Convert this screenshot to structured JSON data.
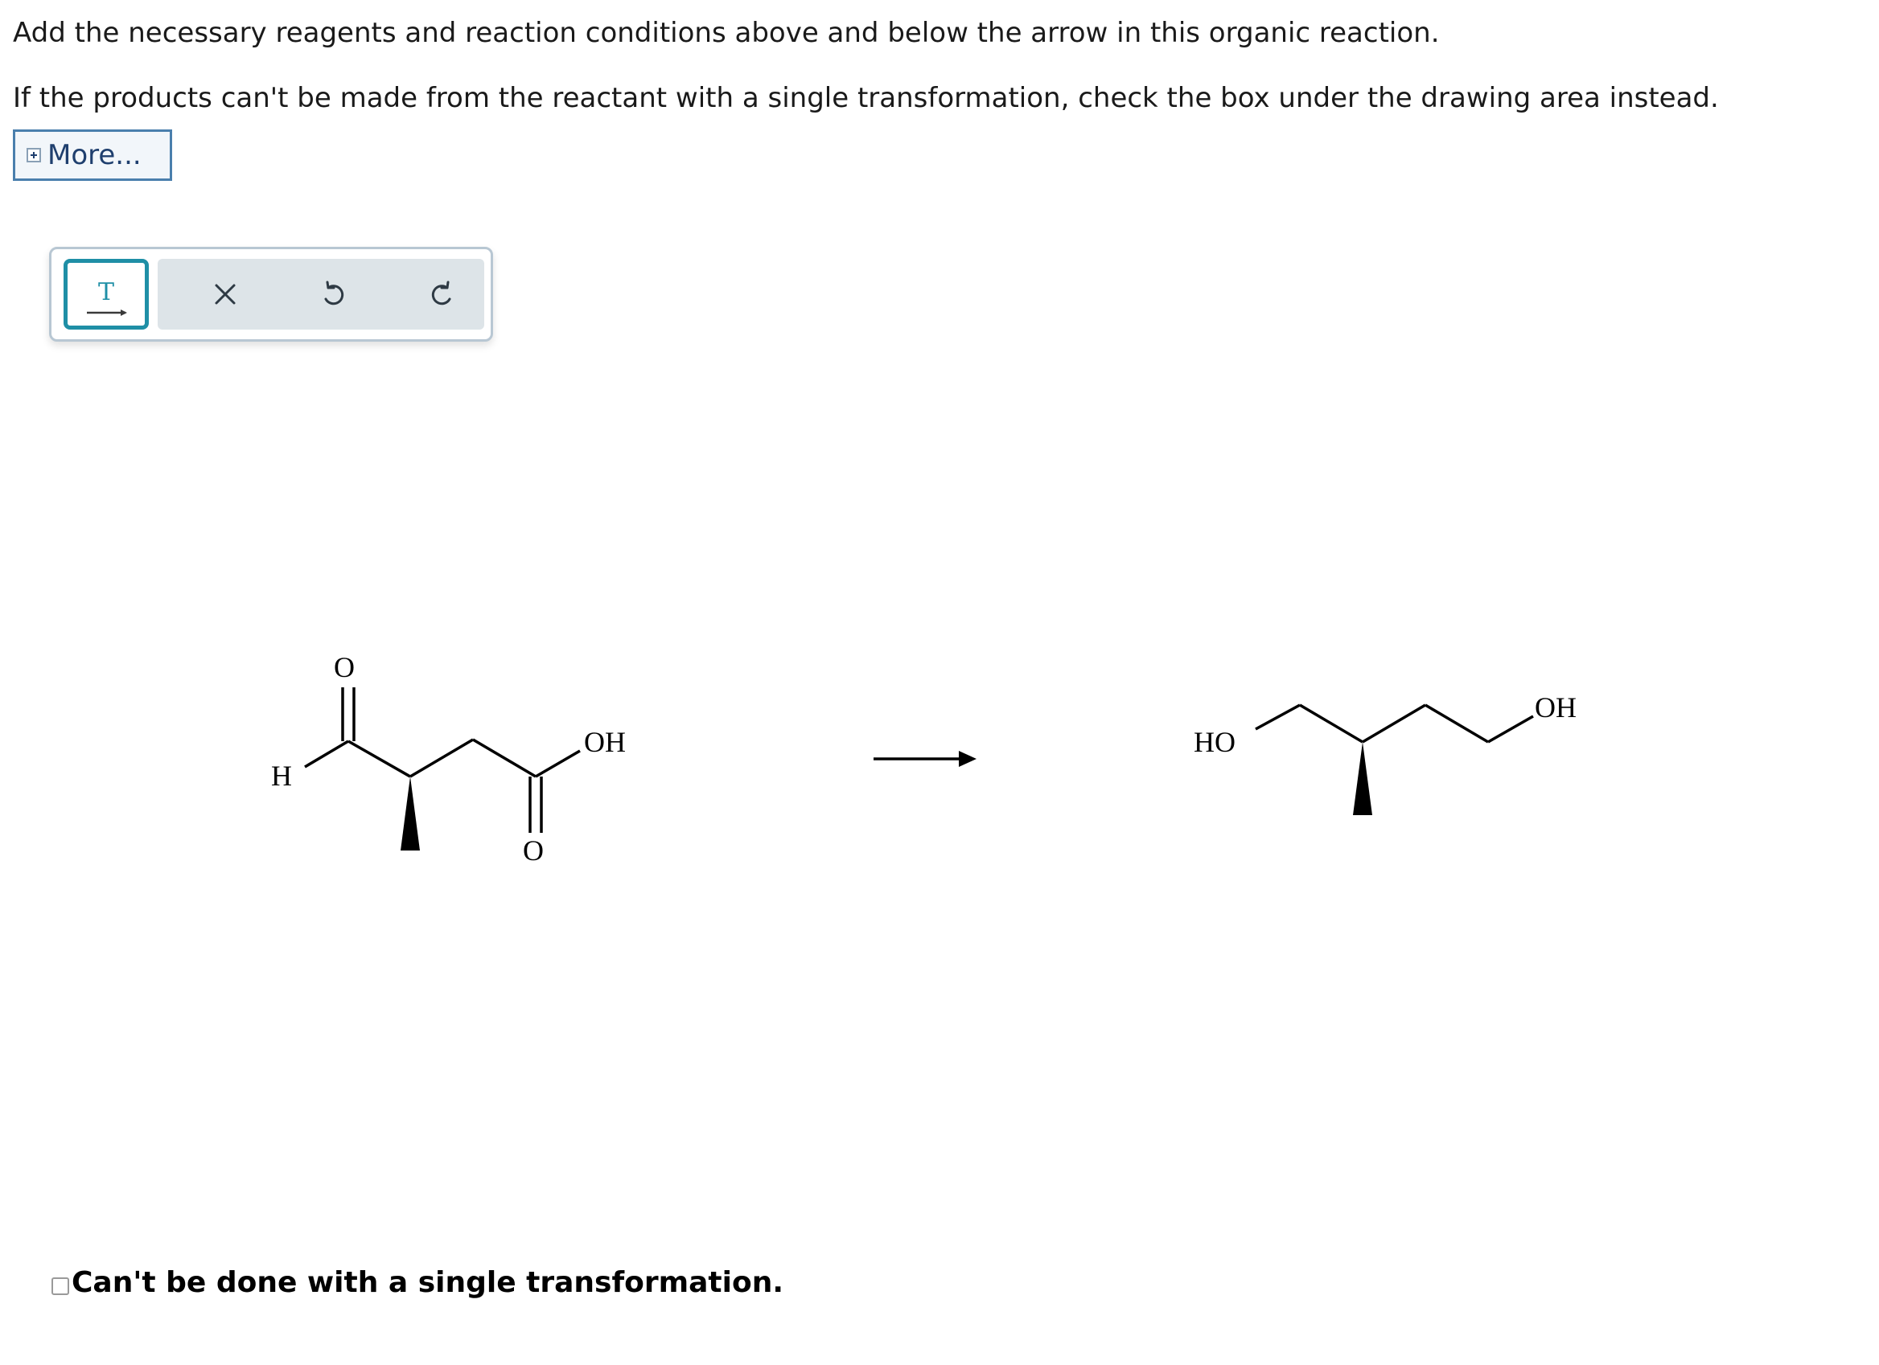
{
  "instructions": {
    "line1": "Add the necessary reagents and reaction conditions above and below the arrow in this organic reaction.",
    "line2": "If the products can't be made from the reactant with a single transformation, check the box under the drawing area instead."
  },
  "more_button": {
    "label": "More..."
  },
  "toolbar": {
    "tools": [
      {
        "name": "arrow-text-tool",
        "icon": "T",
        "selected": true
      },
      {
        "name": "clear",
        "icon": "close-icon",
        "selected": false
      },
      {
        "name": "undo",
        "icon": "undo-icon",
        "selected": false
      },
      {
        "name": "redo",
        "icon": "redo-icon",
        "selected": false
      }
    ]
  },
  "reaction": {
    "reactant": {
      "labels": {
        "o_top": "O",
        "h": "H",
        "oh": "OH",
        "o_bottom": "O"
      }
    },
    "product": {
      "labels": {
        "ho": "HO",
        "oh": "OH"
      }
    }
  },
  "checkbox": {
    "label": "Can't be done with a single transformation.",
    "checked": false
  },
  "colors": {
    "accent": "#1f8fa6",
    "link": "#1f3f6e",
    "border": "#4a7fad"
  }
}
